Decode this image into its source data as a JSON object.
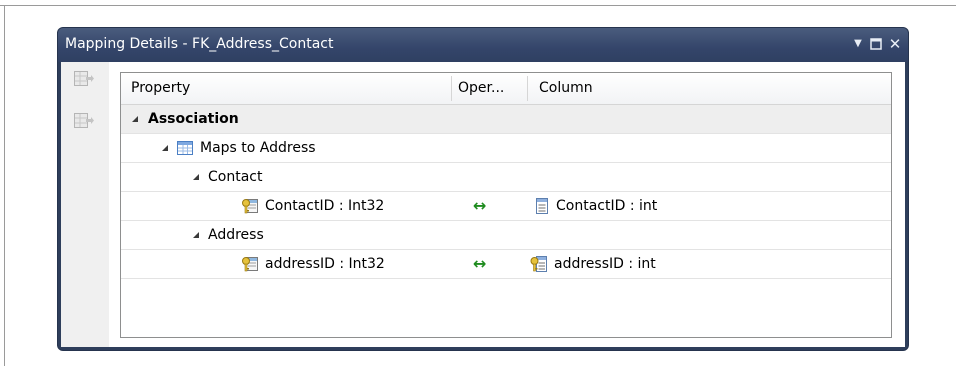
{
  "window": {
    "title": "Mapping Details - FK_Address_Contact",
    "controls": {
      "dropdown_icon": "dropdown-arrow-icon",
      "maximize_icon": "maximize-icon",
      "close_icon": "close-icon"
    }
  },
  "toolbar": {
    "buttons": [
      {
        "icon": "map-entity-icon"
      },
      {
        "icon": "map-association-icon"
      }
    ]
  },
  "grid": {
    "columns": {
      "property": "Property",
      "operator": "Oper...",
      "column": "Column"
    },
    "rows": [
      {
        "level": 0,
        "expanded": true,
        "property": "Association",
        "bold": true
      },
      {
        "level": 1,
        "expanded": true,
        "icon": "table-icon",
        "property": "Maps to Address"
      },
      {
        "level": 2,
        "expanded": true,
        "property": "Contact"
      },
      {
        "level": 3,
        "icon": "key-property-icon",
        "property": "ContactID : Int32",
        "operator": "↔",
        "column_icon": "column-icon",
        "column": "ContactID : int"
      },
      {
        "level": 2,
        "expanded": true,
        "property": "Address"
      },
      {
        "level": 3,
        "icon": "key-property-icon",
        "property": "addressID : Int32",
        "operator": "↔",
        "column_icon": "key-column-icon",
        "column": "addressID : int"
      }
    ]
  },
  "colors": {
    "title_bar": "#34456a",
    "operator_arrow": "#1f8c1f",
    "association_row": "#eeeeee"
  }
}
